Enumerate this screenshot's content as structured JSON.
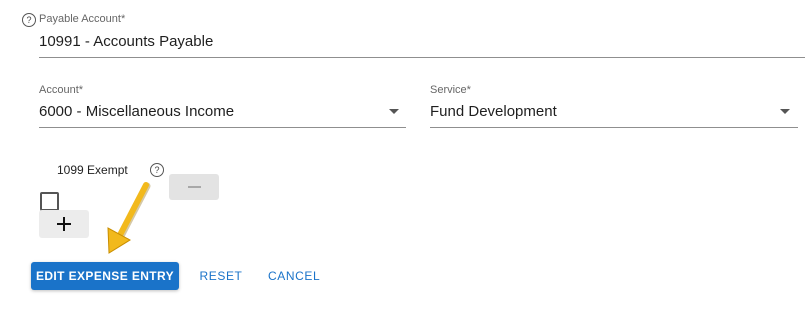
{
  "payable_account": {
    "label": "Payable Account*",
    "value": "10991 - Accounts Payable"
  },
  "account": {
    "label": "Account*",
    "value": "6000 - Miscellaneous Income"
  },
  "service": {
    "label": "Service*",
    "value": "Fund Development"
  },
  "exempt_1099": {
    "label": "1099 Exempt",
    "checked": false
  },
  "help_glyph": "?",
  "icons": {
    "help": "question-circle-icon",
    "dropdown": "chevron-down-icon",
    "minus": "minus-icon",
    "plus": "plus-icon",
    "annotation": "yellow-arrow-annotation"
  },
  "actions": {
    "edit_label": "EDIT EXPENSE ENTRY",
    "reset_label": "RESET",
    "cancel_label": "CANCEL"
  },
  "colors": {
    "primary": "#1a73c9",
    "arrow": "#f2b91c"
  }
}
